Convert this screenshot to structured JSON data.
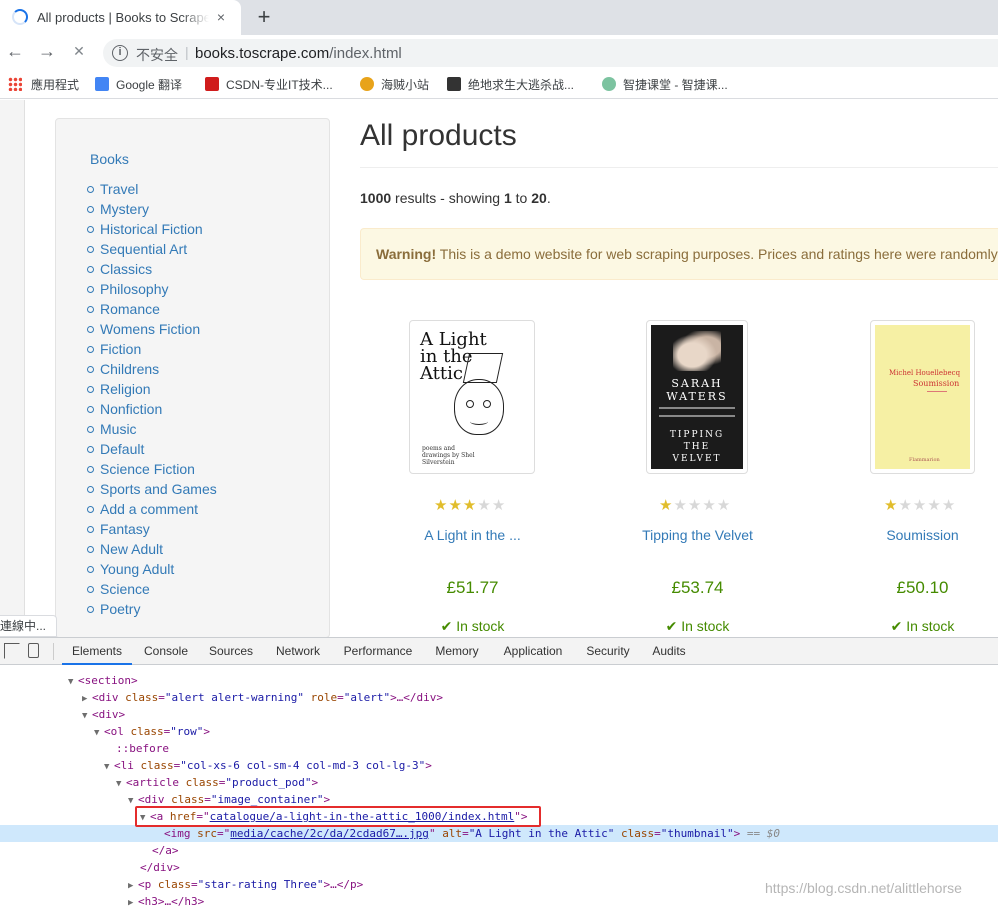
{
  "browser": {
    "tab_title": "All products | Books to Scrape",
    "tab_close": "×",
    "new_tab": "+",
    "back": "←",
    "forward": "→",
    "stop": "✕",
    "security_label": "不安全",
    "url_domain": "books.toscrape.com",
    "url_path": "/index.html",
    "bookmarks": [
      {
        "label": "應用程式"
      },
      {
        "label": "Google 翻译"
      },
      {
        "label": "CSDN-专业IT技术..."
      },
      {
        "label": "海贼小站"
      },
      {
        "label": "绝地求生大逃杀战..."
      },
      {
        "label": "智捷课堂 - 智捷课..."
      }
    ],
    "status_text": "連線中..."
  },
  "sidebar": {
    "title": "Books",
    "categories": [
      "Travel",
      "Mystery",
      "Historical Fiction",
      "Sequential Art",
      "Classics",
      "Philosophy",
      "Romance",
      "Womens Fiction",
      "Fiction",
      "Childrens",
      "Religion",
      "Nonfiction",
      "Music",
      "Default",
      "Science Fiction",
      "Sports and Games",
      "Add a comment",
      "Fantasy",
      "New Adult",
      "Young Adult",
      "Science",
      "Poetry"
    ]
  },
  "main": {
    "title": "All products",
    "results_count": "1000",
    "results_mid": " results - showing ",
    "results_from": "1",
    "results_to_word": " to ",
    "results_to": "20",
    "results_end": ".",
    "alert_strong": "Warning!",
    "alert_text": " This is a demo website for web scraping purposes. Prices and ratings here were randomly assigned"
  },
  "books": [
    {
      "title": "A Light in the ...",
      "price": "£51.77",
      "stock": "In stock",
      "rating": 3,
      "cover_title": "A Light in the Attic",
      "cover_sub": "poems and drawings by Shel Silverstein"
    },
    {
      "title": "Tipping the Velvet",
      "price": "£53.74",
      "stock": "In stock",
      "rating": 1,
      "cover_author": "SARAH WATERS",
      "cover_title": "TIPPING THE VELVET"
    },
    {
      "title": "Soumission",
      "price": "£50.10",
      "stock": "In stock",
      "rating": 1,
      "cover_author": "Michel Houellebecq",
      "cover_title": "Soumission",
      "cover_pub": "Flammarion"
    }
  ],
  "devtools": {
    "tabs": [
      "Elements",
      "Console",
      "Sources",
      "Network",
      "Performance",
      "Memory",
      "Application",
      "Security",
      "Audits"
    ],
    "active_tab": "Elements",
    "dom": {
      "section_open": "<section>",
      "alert_div_a": "<div ",
      "alert_class_attr": "class",
      "alert_class_val": "\"alert alert-warning\"",
      "alert_role_attr": "role",
      "alert_role_val": "\"alert\"",
      "alert_div_close": ">…</div>",
      "div_open": "<div>",
      "ol_open": "<ol ",
      "ol_class_attr": "class",
      "ol_class_val": "\"row\"",
      "before": "::before",
      "li_open": "<li ",
      "li_class_attr": "class",
      "li_class_val": "\"col-xs-6 col-sm-4 col-md-3 col-lg-3\"",
      "article_open": "<article ",
      "article_class_attr": "class",
      "article_class_val": "\"product_pod\"",
      "imgc_open": "<div ",
      "imgc_class_attr": "class",
      "imgc_class_val": "\"image_container\"",
      "a_open": "<a ",
      "a_href_attr": "href",
      "a_href_val": "catalogue/a-light-in-the-attic_1000/index.html",
      "img_open": "<img ",
      "img_src_attr": "src",
      "img_src_val": "media/cache/2c/da/2cdad67….jpg",
      "img_alt_attr": "alt",
      "img_alt_val": "\"A Light in the Attic\"",
      "img_class_attr": "class",
      "img_class_val": "\"thumbnail\"",
      "img_close": ">",
      "eq_marker": "== $0",
      "a_close": "</a>",
      "div_close": "</div>",
      "p_open": "<p ",
      "p_class_attr": "class",
      "p_class_val": "\"star-rating Three\"",
      "p_close": ">…</p>",
      "h3": "<h3>…</h3>"
    }
  },
  "watermark": "https://blog.csdn.net/alittlehorse",
  "colors": {
    "link": "#337ab7",
    "price": "#458B00",
    "star": "#e1bd2c",
    "highlight": "#e42c2c"
  }
}
